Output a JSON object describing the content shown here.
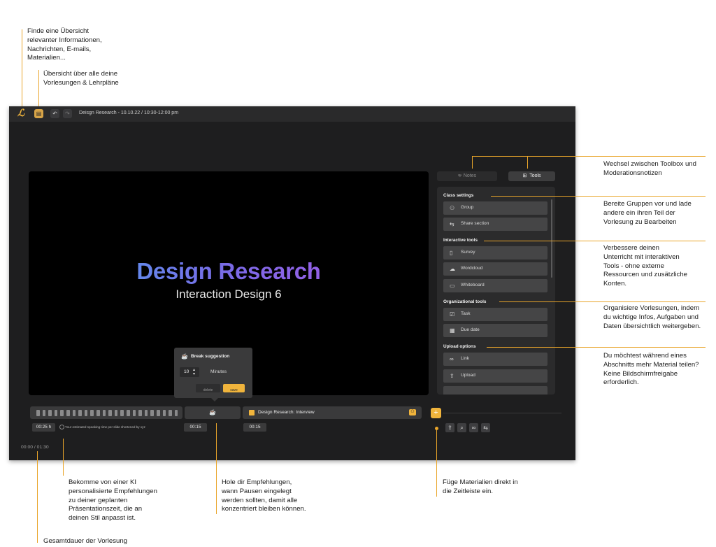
{
  "annotations": {
    "overview": "Finde eine Übersicht\nrelevanter Informationen,\nNachrichten, E-mails,\nMaterialien...",
    "lectures": "Übersicht über alle deine\nVorlesungen & Lehrpläne",
    "toggle": "Wechsel zwischen Toolbox und\nModerationsnotizen",
    "groups": "Bereite Gruppen vor und lade\nandere ein ihren Teil der\nVorlesung zu Bearbeiten",
    "interactive": "Verbessere deinen\nUnterricht mit interaktiven\nTools - ohne externe\nRessourcen und zusätzliche\nKonten.",
    "organize": "Organisiere Vorlesungen, indem\ndu wichtige Infos, Aufgaben und\nDaten übersichtlich weitergeben.",
    "share": "Du möchtest während eines\nAbschnitts mehr Material teilen?\nKeine Bildschirmfreigabe\nerforderlich.",
    "ai": "Bekomme von einer KI\npersonalisierte Empfehlungen\nzu deiner geplanten\nPräsentationszeit, die an\ndeinen Stil anpasst ist.",
    "breaks": "Hole dir Empfehlungen,\nwann Pausen eingelegt\nwerden sollten, damit alle\nkonzentriert bleiben können.",
    "materials": "Füge Materialien direkt in\ndie Zeitleiste ein.",
    "duration": "Gesamtdauer der Vorlesung"
  },
  "topbar": {
    "logo": "ℒ",
    "title": "Deisgn Research - 10.10.22 / 10:30-12:00 pm"
  },
  "slide": {
    "title": "Design Research",
    "subtitle": "Interaction Design 6"
  },
  "tabs": {
    "notes": "Notes",
    "tools": "Tools"
  },
  "panel": {
    "class_settings": "Class settings",
    "group": "Group",
    "share_section": "Share section",
    "interactive_tools": "Interactive tools",
    "survey": "Survey",
    "wordcloud": "Wordcloud",
    "whiteboard": "Whiteboard",
    "organizational_tools": "Organizational tools",
    "task": "Task",
    "due_date": "Due date",
    "upload_options": "Upload options",
    "link": "Link",
    "upload": "Upload"
  },
  "popup": {
    "title": "Break suggestion",
    "minutes_value": "10",
    "minutes_label": "Minutes",
    "delete": "delete",
    "save": "save"
  },
  "timeline": {
    "segment_label": "Design Research: Interview",
    "estimate": "00:25 h",
    "estimate_note": "Your estimated speaking time per slide shortened by xyz",
    "break_time": "00:15",
    "segment_time": "00:15",
    "total": "00:00 / 01:30"
  },
  "colors": {
    "accent": "#f0b43c",
    "annotation_line": "#e9a52a",
    "app_bg": "#1e1e1f"
  }
}
